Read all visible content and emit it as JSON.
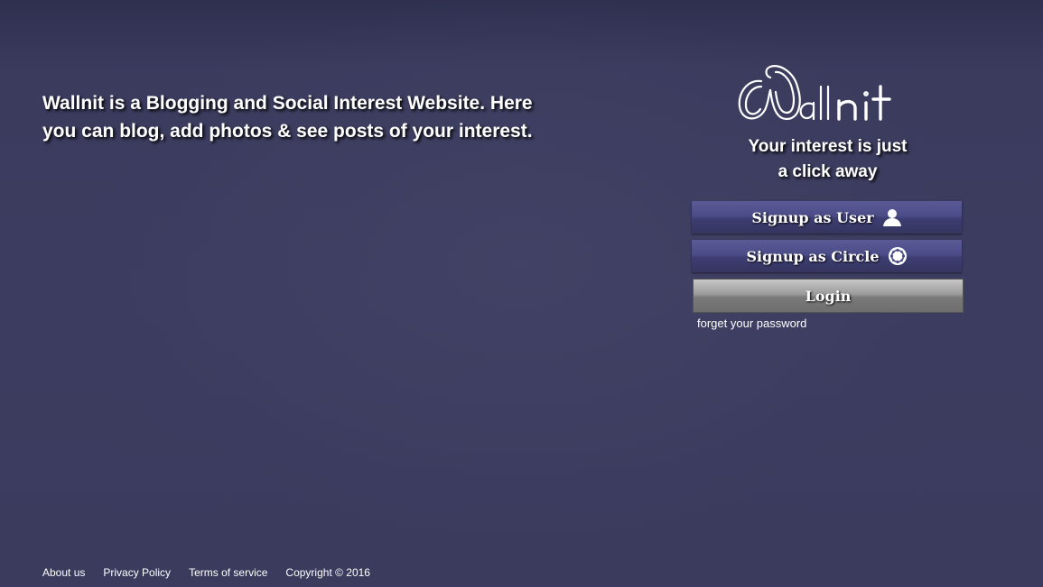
{
  "tagline": "Wallnit is a Blogging and Social Interest Website. Here you can blog, add photos & see posts of your interest.",
  "logo": {
    "brand_name": "Wallnit"
  },
  "slogan": {
    "line1": "Your interest is just",
    "line2": "a click away"
  },
  "buttons": {
    "signup_user": "Signup as User",
    "signup_circle": "Signup as Circle",
    "login": "Login"
  },
  "icons": {
    "signup_user": "user-icon",
    "signup_circle": "circle-group-icon"
  },
  "forgot_password": "forget your password",
  "footer": {
    "about": "About us",
    "privacy": "Privacy Policy",
    "terms": "Terms of service",
    "copyright": "Copyright © 2016"
  },
  "colors": {
    "background": "#3b3b5e",
    "signup_button": "#4c4c88",
    "login_button": "#8a8a8a",
    "text": "#ffffff"
  }
}
